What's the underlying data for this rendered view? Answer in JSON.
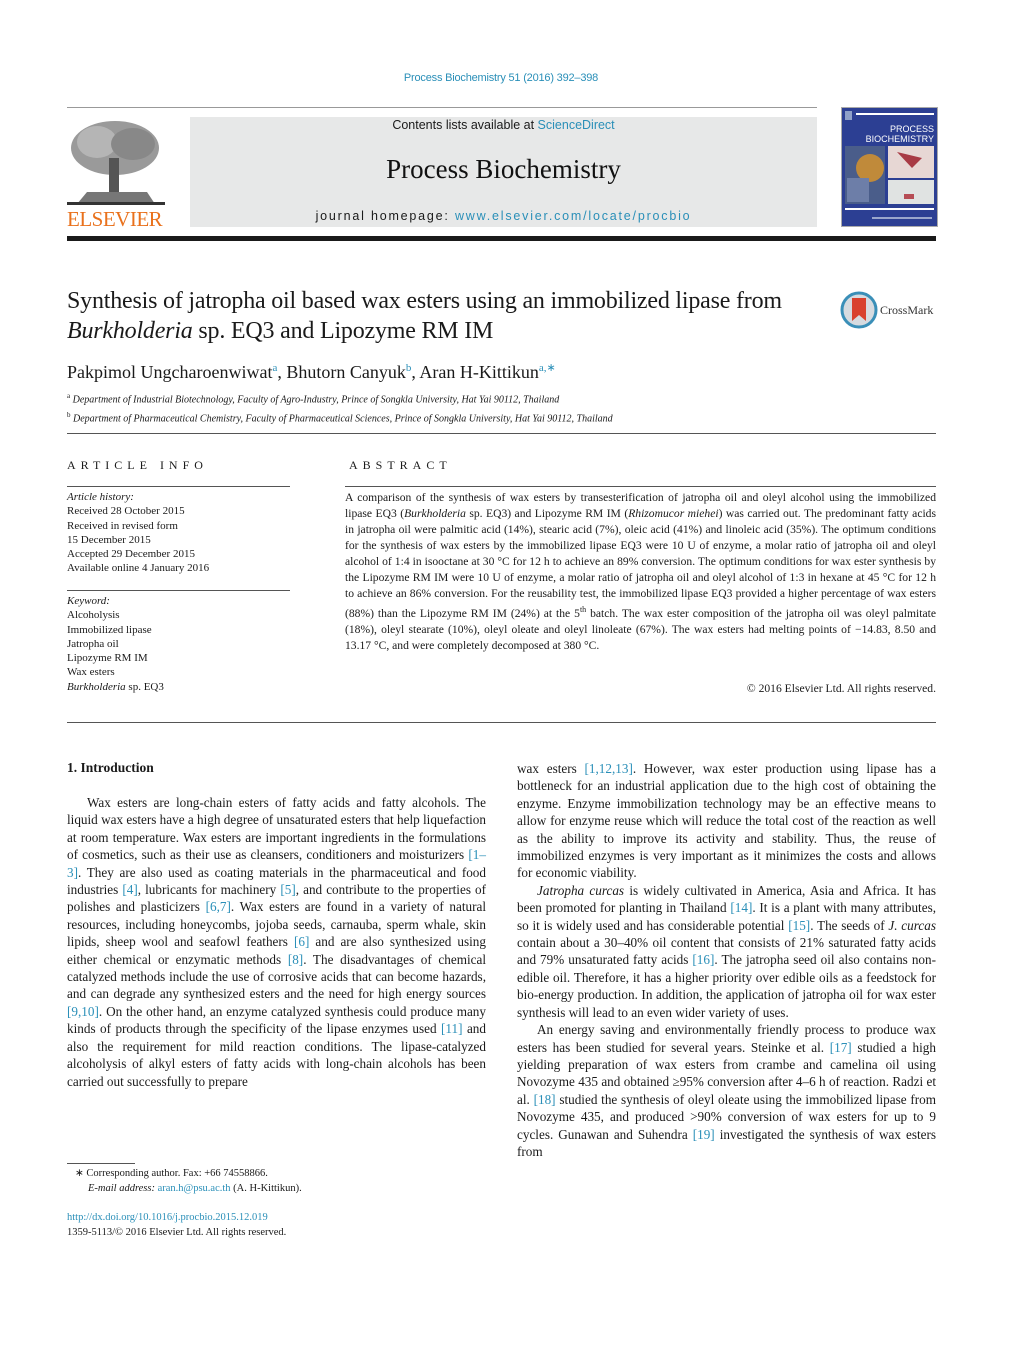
{
  "header": {
    "citation": "Process Biochemistry 51 (2016) 392–398",
    "publisher_logo_text": "ELSEVIER",
    "contents_prefix": "Contents lists available at ",
    "contents_link": "ScienceDirect",
    "journal_title": "Process Biochemistry",
    "homepage_prefix": "journal homepage: ",
    "homepage_link": "www.elsevier.com/locate/procbio",
    "cover_title_line1": "PROCESS",
    "cover_title_line2": "BIOCHEMISTRY",
    "crossmark_label": "CrossMark"
  },
  "article": {
    "title_part1": "Synthesis of jatropha oil based wax esters using an immobilized lipase from ",
    "title_italic": "Burkholderia",
    "title_part2": " sp. EQ3 and Lipozyme RM IM",
    "authors": [
      {
        "name": "Pakpimol Ungcharoenwiwat",
        "aff": "a"
      },
      {
        "name": "Bhutorn Canyuk",
        "aff": "b"
      },
      {
        "name": "Aran H-Kittikun",
        "aff": "a,∗"
      }
    ],
    "affiliations": [
      {
        "key": "a",
        "text": "Department of Industrial Biotechnology, Faculty of Agro-Industry, Prince of Songkla University, Hat Yai 90112, Thailand"
      },
      {
        "key": "b",
        "text": "Department of Pharmaceutical Chemistry, Faculty of Pharmaceutical Sciences, Prince of Songkla University, Hat Yai 90112, Thailand"
      }
    ]
  },
  "article_info": {
    "heading": "ARTICLE INFO",
    "history_label": "Article history:",
    "history": [
      "Received 28 October 2015",
      "Received in revised form",
      "15 December 2015",
      "Accepted 29 December 2015",
      "Available online 4 January 2016"
    ],
    "keyword_label": "Keyword:",
    "keywords": [
      "Alcoholysis",
      "Immobilized lipase",
      "Jatropha oil",
      "Lipozyme RM IM",
      "Wax esters"
    ],
    "last_keyword_italic": "Burkholderia",
    "last_keyword_rest": " sp. EQ3"
  },
  "abstract": {
    "heading": "ABSTRACT",
    "s1": "A comparison of the synthesis of wax esters by transesterification of jatropha oil and oleyl alcohol using the immobilized lipase EQ3 (",
    "s1_it1": "Burkholderia",
    "s1_b": " sp. EQ3) and Lipozyme RM IM (",
    "s1_it2": "Rhizomucor miehei",
    "s1_c": ") was carried out. The predominant fatty acids in jatropha oil were palmitic acid (14%), stearic acid (7%), oleic acid (41%) and linoleic acid (35%). The optimum conditions for the synthesis of wax esters by the immobilized lipase EQ3 were 10 U of enzyme, a molar ratio of jatropha oil and oleyl alcohol of 1:4 in isooctane at 30 °C for 12 h to achieve an 89% conversion. The optimum conditions for wax ester synthesis by the Lipozyme RM IM were 10 U of enzyme, a molar ratio of jatropha oil and oleyl alcohol of 1:3 in hexane at 45 °C for 12 h to achieve an 86% conversion. For the reusability test, the immobilized lipase EQ3 provided a higher percentage of wax esters (88%) than the Lipozyme RM IM (24%) at the 5",
    "sup_th": "th",
    "s2": " batch. The wax ester composition of the jatropha oil was oleyl palmitate (18%), oleyl stearate (10%), oleyl oleate and oleyl linoleate (67%). The wax esters had melting points of −14.83, 8.50 and 13.17 °C, and were completely decomposed at 380 °C.",
    "copyright": "© 2016 Elsevier Ltd. All rights reserved."
  },
  "introduction": {
    "heading": "1.  Introduction",
    "p1": [
      {
        "t": "Wax esters are long-chain esters of fatty acids and fatty alcohols. The liquid wax esters have a high degree of unsaturated esters that help liquefaction at room temperature. Wax esters are important ingredients in the formulations of cosmetics, such as their use as cleansers, conditioners and moisturizers "
      },
      {
        "ref": "[1–3]"
      },
      {
        "t": ". They are also used as coating materials in the pharmaceutical and food industries "
      },
      {
        "ref": "[4]"
      },
      {
        "t": ", lubricants for machinery "
      },
      {
        "ref": "[5]"
      },
      {
        "t": ", and contribute to the properties of polishes and plasticizers "
      },
      {
        "ref": "[6,7]"
      },
      {
        "t": ". Wax esters are found in a variety of natural resources, including honeycombs, jojoba seeds, carnauba, sperm whale, skin lipids, sheep wool and seafowl feathers "
      },
      {
        "ref": "[6]"
      },
      {
        "t": " and are also synthesized using either chemical or enzymatic methods "
      },
      {
        "ref": "[8]"
      },
      {
        "t": ". The disadvantages of chemical catalyzed methods include the use of corrosive acids that can become hazards, and can degrade any synthesized esters and the need for high energy sources "
      },
      {
        "ref": "[9,10]"
      },
      {
        "t": ". On the other hand, an enzyme catalyzed synthesis could produce many kinds of products through the specificity of the lipase enzymes used "
      },
      {
        "ref": "[11]"
      },
      {
        "t": " and also the requirement for mild reaction conditions. The lipase-catalyzed alcoholysis of alkyl esters of fatty acids with long-chain alcohols has been carried out successfully to prepare wax esters "
      },
      {
        "ref": "[1,12,13]"
      },
      {
        "t": ". However, wax ester production using lipase has a bottleneck for an industrial application due to the high cost of obtaining the enzyme. Enzyme immobilization technology may be an effective means to allow for enzyme reuse which will reduce the total cost of the reaction as well as the ability to improve its activity and stability. Thus, the reuse of immobilized enzymes is very important as it minimizes the costs and allows for economic viability."
      }
    ],
    "p2": [
      {
        "it": "Jatropha curcas"
      },
      {
        "t": " is widely cultivated in America, Asia and Africa. It has been promoted for planting in Thailand "
      },
      {
        "ref": "[14]"
      },
      {
        "t": ". It is a plant with many attributes, so it is widely used and has considerable potential "
      },
      {
        "ref": "[15]"
      },
      {
        "t": ". The seeds of "
      },
      {
        "it": "J. curcas"
      },
      {
        "t": " contain about a 30–40% oil content that consists of 21% saturated fatty acids and 79% unsaturated fatty acids "
      },
      {
        "ref": "[16]"
      },
      {
        "t": ". The jatropha seed oil also contains non-edible oil. Therefore, it has a higher priority over edible oils as a feedstock for bio-energy production. In addition, the application of jatropha oil for wax ester synthesis will lead to an even wider variety of uses."
      }
    ],
    "p3": [
      {
        "t": "An energy saving and environmentally friendly process to produce wax esters has been studied for several years. Steinke et al. "
      },
      {
        "ref": "[17]"
      },
      {
        "t": " studied a high yielding preparation of wax esters from crambe and camelina oil using Novozyme 435 and obtained ≥95% conversion after 4–6 h of reaction. Radzi et al. "
      },
      {
        "ref": "[18]"
      },
      {
        "t": " studied the synthesis of oleyl oleate using the immobilized lipase from Novozyme 435, and produced >90% conversion of wax esters for up to 9 cycles. Gunawan and Suhendra "
      },
      {
        "ref": "[19]"
      },
      {
        "t": " investigated the synthesis of wax esters from"
      }
    ]
  },
  "footnotes": {
    "corresponding": "∗  Corresponding author. Fax: +66 74558866.",
    "email_label": "E-mail address: ",
    "email": "aran.h@psu.ac.th",
    "email_suffix": " (A. H-Kittikun).",
    "doi": "http://dx.doi.org/10.1016/j.procbio.2015.12.019",
    "issn": "1359-5113/© 2016 Elsevier Ltd. All rights reserved."
  }
}
